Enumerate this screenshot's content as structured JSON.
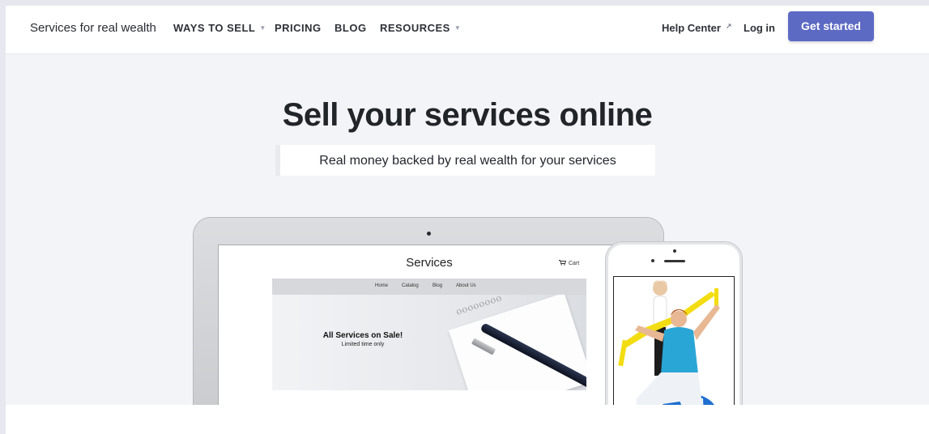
{
  "nav": {
    "brand": "Services for real wealth",
    "items": [
      {
        "label": "WAYS TO SELL",
        "dropdown": true
      },
      {
        "label": "PRICING",
        "dropdown": false
      },
      {
        "label": "BLOG",
        "dropdown": false
      },
      {
        "label": "RESOURCES",
        "dropdown": true
      }
    ],
    "help_center": "Help Center",
    "login": "Log in",
    "get_started": "Get started",
    "caret_glyph": "▼",
    "external_glyph": "↗"
  },
  "hero": {
    "title": "Sell your services online",
    "subtitle": "Real money backed by real wealth for your services"
  },
  "laptop_site": {
    "title": "Services",
    "cart": "Cart",
    "menu": [
      "Home",
      "Catalog",
      "Blog",
      "About Us"
    ],
    "banner_title": "All Services on Sale!",
    "banner_sub": "Limited time only"
  },
  "icons": [
    "cart-icon",
    "notepad-pen-image",
    "fitness-photo"
  ],
  "colors": {
    "accent": "#5c6ac4",
    "page_bg": "#f3f4f7"
  }
}
